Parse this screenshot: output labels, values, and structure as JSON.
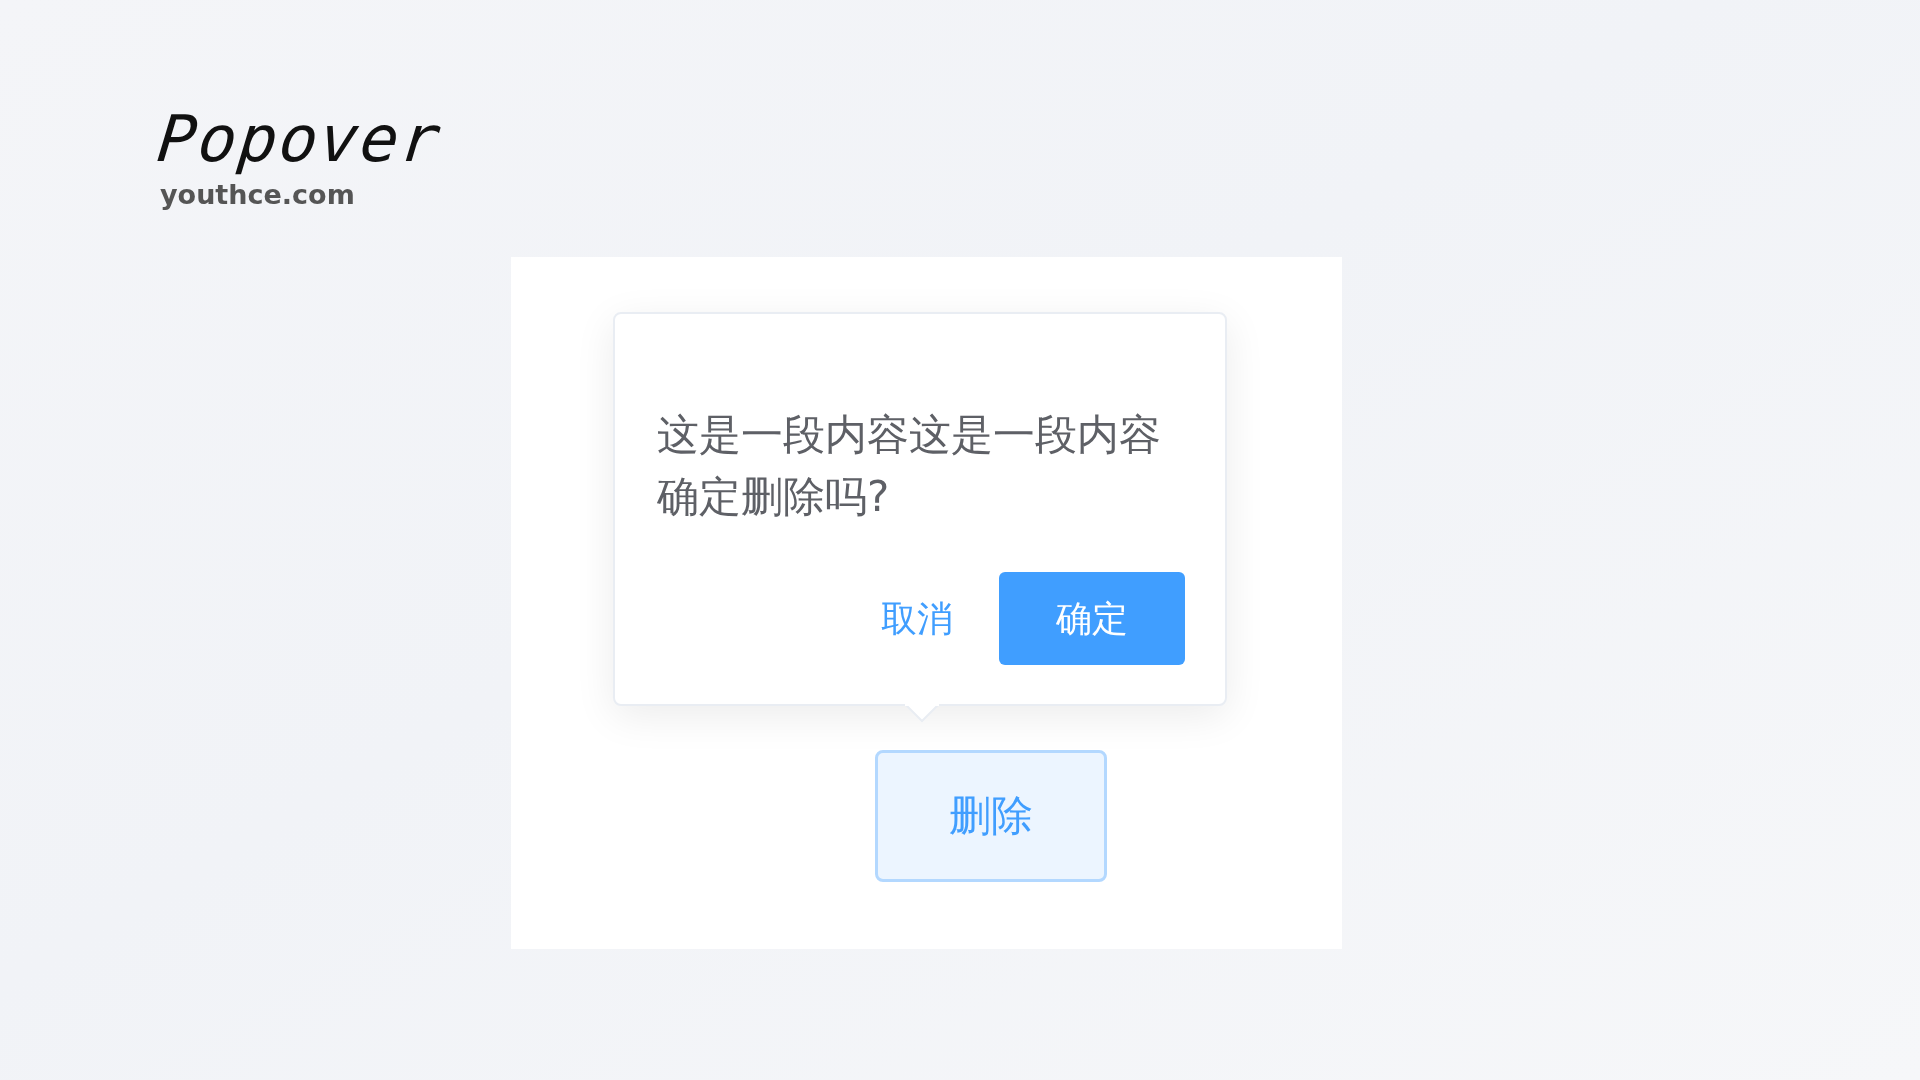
{
  "header": {
    "title": "Popover",
    "site": "youthce.com"
  },
  "popover": {
    "message": "这是一段内容这是一段内容确定删除吗?",
    "buttons": [
      {
        "label": "取消",
        "kind": "text"
      },
      {
        "label": "确定",
        "kind": "primary"
      }
    ]
  },
  "trigger_button": {
    "label": "删除"
  }
}
